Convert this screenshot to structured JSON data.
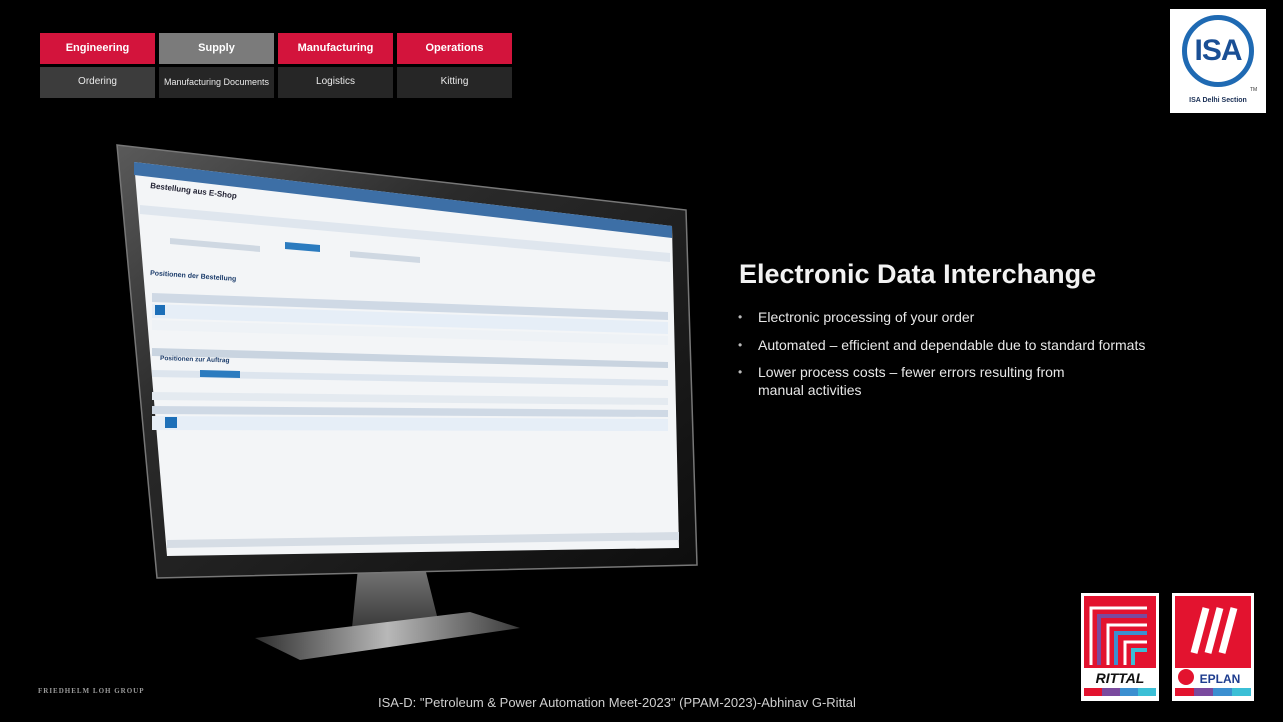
{
  "nav": {
    "row1": [
      "Engineering",
      "Supply",
      "Manufacturing",
      "Operations"
    ],
    "row2": [
      "Ordering",
      "Manufacturing Documents",
      "Logistics",
      "Kitting"
    ]
  },
  "logo": {
    "isa_text": "ISA",
    "isa_tm": "TM",
    "isa_caption": "ISA Delhi Section"
  },
  "content": {
    "heading": "Electronic Data Interchange",
    "bullets": [
      "Electronic processing of your order",
      "Automated – efficient and dependable due to standard formats",
      "Lower process costs – fewer errors resulting from manual activities"
    ]
  },
  "screen": {
    "window_title": "Bestellung aus E-Shop",
    "section_title": "Positionen der Bestellung",
    "section_title_2": "Positionen zur Auftrag"
  },
  "brands": {
    "rittal": "RITTAL",
    "eplan": "EPLAN"
  },
  "footer": {
    "left": "FRIEDHELM LOH GROUP",
    "center": "ISA-D: \"Petroleum & Power Automation Meet-2023\" (PPAM-2023)-Abhinav G-Rittal"
  },
  "colors": {
    "nav_red": "#d3143c",
    "nav_gray": "#7b7b7b",
    "isa_blue": "#1f6ab3",
    "rittal_red": "#e3132f"
  }
}
